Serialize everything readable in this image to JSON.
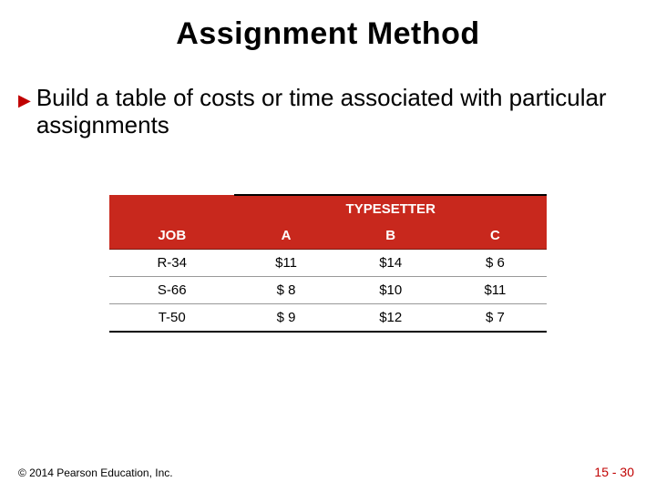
{
  "title": "Assignment Method",
  "bullet": {
    "marker": "▶",
    "text": "Build a table of costs or time associated with particular assignments"
  },
  "table": {
    "group_header_blank": "",
    "group_header": "TYPESETTER",
    "columns": {
      "job": "JOB",
      "a": "A",
      "b": "B",
      "c": "C"
    },
    "rows": [
      {
        "job": "R-34",
        "a": "$11",
        "b": "$14",
        "c": "$  6"
      },
      {
        "job": "S-66",
        "a": "$  8",
        "b": "$10",
        "c": "$11"
      },
      {
        "job": "T-50",
        "a": "$  9",
        "b": "$12",
        "c": "$  7"
      }
    ]
  },
  "footer": {
    "copyright": "© 2014 Pearson Education, Inc.",
    "page": "15 - 30"
  },
  "chart_data": {
    "type": "table",
    "title": "Assignment Method cost table",
    "row_label": "JOB",
    "column_group": "TYPESETTER",
    "columns": [
      "A",
      "B",
      "C"
    ],
    "rows": [
      "R-34",
      "S-66",
      "T-50"
    ],
    "values": [
      [
        11,
        14,
        6
      ],
      [
        8,
        10,
        11
      ],
      [
        9,
        12,
        7
      ]
    ],
    "unit": "USD"
  }
}
